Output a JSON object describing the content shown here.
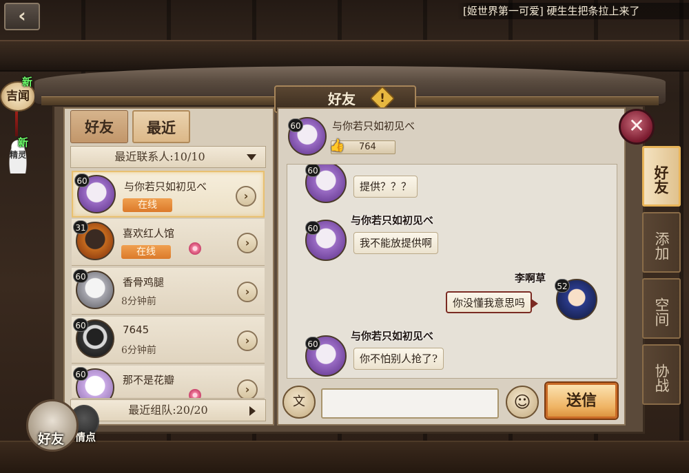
{
  "top": {
    "back_icon": "back-arrow-icon",
    "marquee": "[姬世界第一可爱] 硬生生把条拉上来了"
  },
  "left_icons": {
    "news_label": "吉闻",
    "new_badge": "新",
    "spirit_label": "精灵",
    "spirit_badge": "新"
  },
  "panel": {
    "title": "好友"
  },
  "left_panel": {
    "tabs": [
      {
        "label": "好友",
        "active": false
      },
      {
        "label": "最近",
        "active": true
      }
    ],
    "recent_header": "最近联系人:10/10",
    "friends": [
      {
        "level": "60",
        "name": "与你若只如初见べ",
        "status": "在线",
        "online": true
      },
      {
        "level": "31",
        "name": "喜欢红人馆",
        "status": "在线",
        "online": true
      },
      {
        "level": "60",
        "name": "香骨鸡腿",
        "status": "8分钟前",
        "online": false
      },
      {
        "level": "60",
        "name": "7645",
        "status": "6分钟前",
        "online": false
      },
      {
        "level": "60",
        "name": "那不是花瓣",
        "status": "",
        "online": false
      }
    ],
    "team_footer": "最近组队:20/20"
  },
  "chat": {
    "header": {
      "level": "60",
      "name": "与你若只如初见べ",
      "likes": "764"
    },
    "messages": [
      {
        "sender": "",
        "level": "60",
        "text": "提供？？？",
        "mine": false
      },
      {
        "sender": "与你若只如初见べ",
        "level": "60",
        "text": "我不能放提供啊",
        "mine": false
      },
      {
        "sender": "李啊草",
        "level": "52",
        "text": "你没懂我意思吗",
        "mine": true
      },
      {
        "sender": "与你若只如初见べ",
        "level": "60",
        "text": "你不怕别人抢了?",
        "mine": false
      }
    ],
    "input_placeholder": "",
    "send_label": "送信",
    "voice_glyph": "文"
  },
  "side_tabs": [
    {
      "label": "好友",
      "active": true
    },
    {
      "label": "添加",
      "active": false
    },
    {
      "label": "空间",
      "active": false
    },
    {
      "label": "协战",
      "active": false
    }
  ],
  "bottom": {
    "friends_label": "好友",
    "faces_label": "情点"
  },
  "colors": {
    "accent": "#e8b458",
    "online": "#dc7a2a",
    "panel_bg": "#d7ccb9"
  }
}
